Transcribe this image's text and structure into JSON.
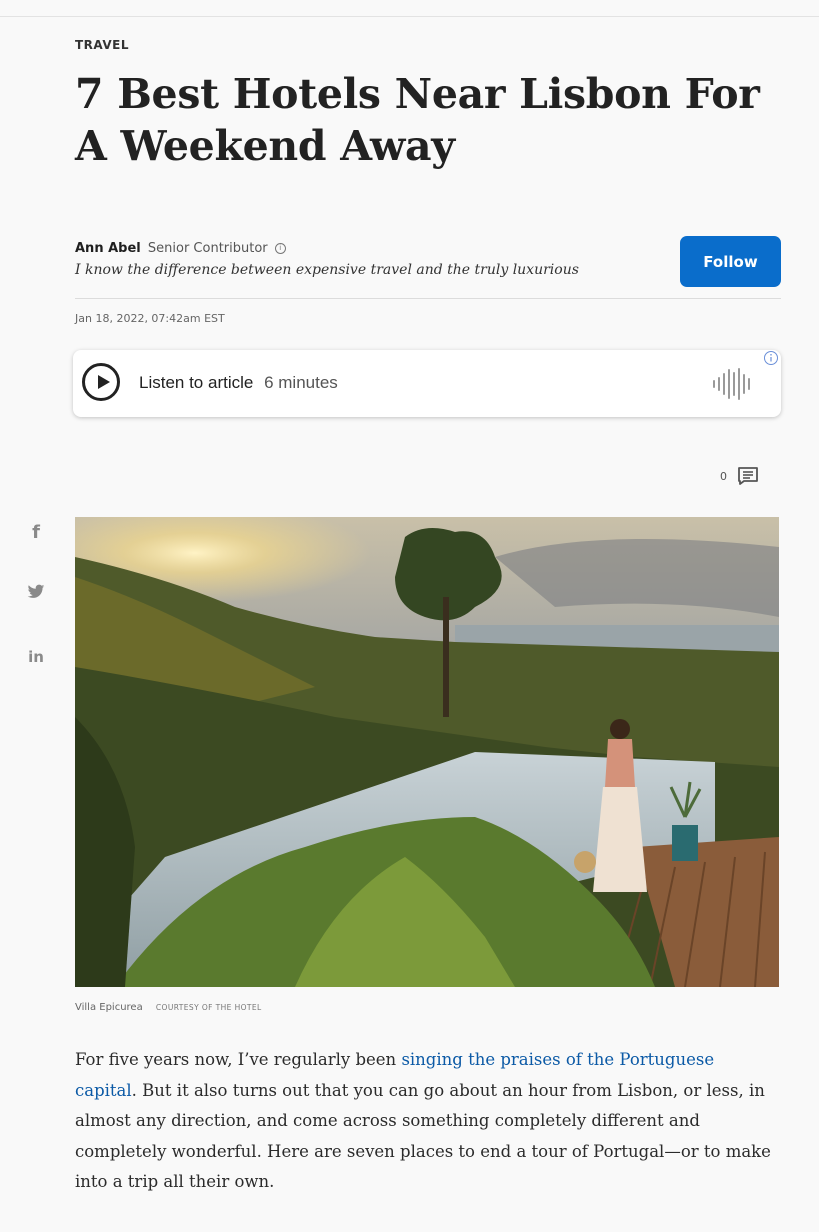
{
  "article": {
    "category": "TRAVEL",
    "title": "7 Best Hotels Near Lisbon For A Weekend Away",
    "author": {
      "name": "Ann Abel",
      "role": "Senior Contributor",
      "info_icon": "info-circle-icon",
      "tagline": "I know the difference between expensive travel and the truly luxurious",
      "follow_label": "Follow"
    },
    "dateline": "Jan 18, 2022, 07:42am EST",
    "listen": {
      "label": "Listen to article",
      "duration": "6 minutes",
      "play_icon": "play-circle-icon",
      "waveform_icon": "audio-waveform-icon",
      "ad_icon": "info-icon"
    },
    "comments": {
      "count": "0",
      "icon": "comment-icon"
    },
    "share": [
      {
        "network": "facebook",
        "glyph": "f",
        "icon": "facebook-icon"
      },
      {
        "network": "twitter",
        "glyph": "",
        "icon": "twitter-icon"
      },
      {
        "network": "linkedin",
        "glyph": "in",
        "icon": "linkedin-icon"
      }
    ],
    "image": {
      "caption": "Villa Epicurea",
      "credit": "COURTESY OF THE HOTEL"
    },
    "body": {
      "intro": "For five years now, I’ve regularly been ",
      "link_text": "singing the praises of the Portuguese capital",
      "rest": ". But it also turns out that you can go about an hour from Lisbon, or less, in almost any direction, and come across something completely different and completely wonderful. Here are seven places to end a tour of Portugal—or to make into a trip all their own."
    }
  },
  "colors": {
    "follow_button": "#0a6dcb",
    "link": "#0c5aa6",
    "background": "#f9f9f9",
    "text": "#222222"
  }
}
